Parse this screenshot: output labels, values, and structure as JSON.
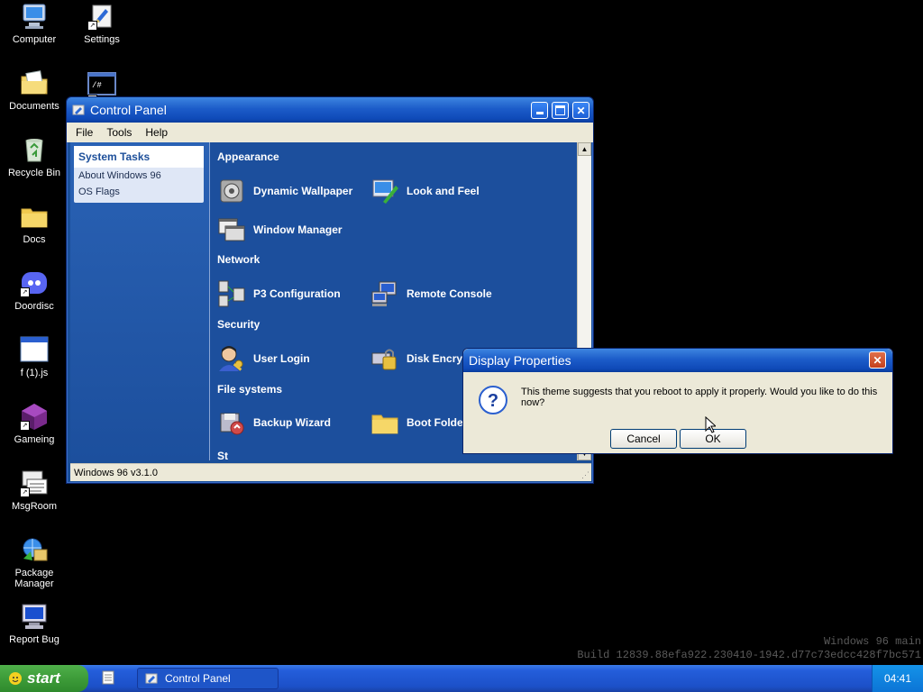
{
  "desktop": {
    "icons": [
      {
        "label": "Computer"
      },
      {
        "label": "Settings"
      },
      {
        "label": "Documents"
      },
      {
        "label": ""
      },
      {
        "label": "Recycle Bin"
      },
      {
        "label": "Docs"
      },
      {
        "label": "Doordisc"
      },
      {
        "label": "f (1).js"
      },
      {
        "label": "Gameing"
      },
      {
        "label": "MsgRoom"
      },
      {
        "label": "Package Manager"
      },
      {
        "label": "Report Bug"
      }
    ],
    "terminal_glyph": "/#",
    "watermark_line1": "Windows 96 main",
    "watermark_line2": "Build 12839.88efa922.230410-1942.d77c73edcc428f7bc571"
  },
  "control_panel": {
    "title": "Control Panel",
    "menu": [
      "File",
      "Tools",
      "Help"
    ],
    "tasks_header": "System Tasks",
    "tasks": [
      "About Windows 96",
      "OS Flags"
    ],
    "sections": {
      "appearance": "Appearance",
      "network": "Network",
      "security": "Security",
      "file_systems": "File systems",
      "storage_partial": "St"
    },
    "items": {
      "dynamic_wallpaper": "Dynamic Wallpaper",
      "look_and_feel": "Look and Feel",
      "window_manager": "Window Manager",
      "p3_configuration": "P3 Configuration",
      "remote_console": "Remote Console",
      "user_login": "User Login",
      "disk_encryption": "Disk Encryption",
      "backup_wizard": "Backup Wizard",
      "boot_folder": "Boot Folder"
    },
    "status": "Windows 96 v3.1.0"
  },
  "dialog": {
    "title": "Display Properties",
    "message": "This theme suggests that you reboot to apply it properly. Would you like to do this now?",
    "cancel": "Cancel",
    "ok": "OK"
  },
  "taskbar": {
    "start": "start",
    "task": "Control Panel",
    "clock": "04:41"
  },
  "colors": {
    "titlebar": "#0f4ab8",
    "panel_blue": "#1c4f9d",
    "start_green": "#3d9c39",
    "taskbar_blue": "#245edb"
  }
}
